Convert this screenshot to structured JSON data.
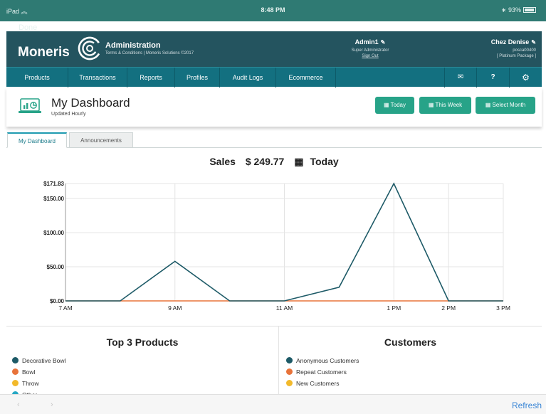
{
  "statusbar": {
    "device": "iPad",
    "time": "8:48 PM",
    "battery": "93%"
  },
  "done_label": "Done",
  "header": {
    "logo_word": "Moneris",
    "admin_title": "Administration",
    "admin_subtitle": "Terms & Conditions | Moneris Solutions ©2017",
    "user_name": "Admin1",
    "user_role": "Super Administrator",
    "sign_out": "Sign Out",
    "store_name": "Chez Denise",
    "store_id": "posca00400",
    "store_package": "[ Platinum Package ]"
  },
  "nav": {
    "items": [
      "Products",
      "Transactions",
      "Reports",
      "Profiles",
      "Audit Logs",
      "Ecommerce"
    ],
    "icons": {
      "mail": "✉",
      "help": "?",
      "settings": "⚙"
    }
  },
  "page": {
    "title": "My Dashboard",
    "subtitle": "Updated Hourly"
  },
  "buttons": {
    "today": "Today",
    "week": "This Week",
    "month": "Select Month"
  },
  "tabs": {
    "active": "My Dashboard",
    "inactive": "Announcements"
  },
  "sales": {
    "label": "Sales",
    "amount": "$ 249.77",
    "period": "Today"
  },
  "chart_data": {
    "type": "line",
    "x": [
      "7 AM",
      "8 AM",
      "9 AM",
      "10 AM",
      "11 AM",
      "12 PM",
      "1 PM",
      "2 PM",
      "3 PM"
    ],
    "x_tick_labels": [
      "7 AM",
      "9 AM",
      "11 AM",
      "1 PM",
      "2 PM",
      "3 PM"
    ],
    "y_tick_labels": [
      "$171.83",
      "$150.00",
      "$100.00",
      "$50.00",
      "$0.00"
    ],
    "ylim": [
      0,
      171.83
    ],
    "series": [
      {
        "color": "#1d5a67",
        "values": [
          0,
          0,
          58,
          0,
          0,
          20,
          171.83,
          0,
          0
        ]
      },
      {
        "color": "#e8733a",
        "values": [
          0,
          0,
          0,
          0,
          0,
          0,
          0,
          0,
          0
        ]
      }
    ],
    "title": "",
    "xlabel": "",
    "ylabel": "",
    "grid": true
  },
  "products": {
    "title": "Top 3 Products",
    "items": [
      {
        "label": "Decorative Bowl",
        "color": "#1d5a67"
      },
      {
        "label": "Bowl",
        "color": "#e8733a"
      },
      {
        "label": "Throw",
        "color": "#f2b92b"
      },
      {
        "label": "Other",
        "color": "#27a8c4"
      }
    ]
  },
  "customers": {
    "title": "Customers",
    "items": [
      {
        "label": "Anonymous Customers",
        "color": "#1d5a67"
      },
      {
        "label": "Repeat Customers",
        "color": "#e8733a"
      },
      {
        "label": "New Customers",
        "color": "#f2b92b"
      }
    ]
  },
  "bottombar": {
    "back": "‹",
    "forward": "›",
    "refresh": "Refresh"
  }
}
